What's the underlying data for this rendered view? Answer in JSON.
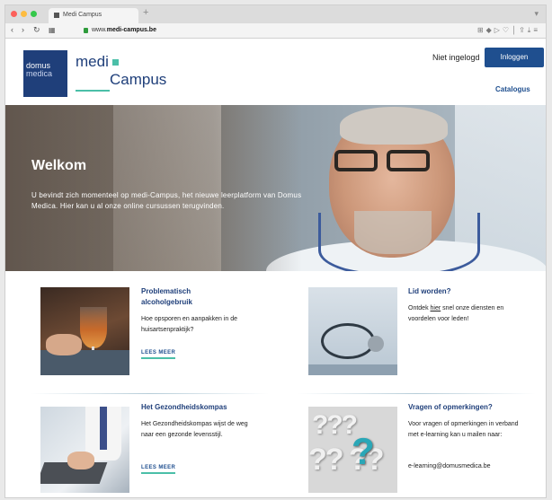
{
  "browser": {
    "tab_title": "Medi Campus",
    "url_prefix": "www.",
    "url_domain": "medi-campus.be",
    "new_tab": "+"
  },
  "header": {
    "logo_domus_line1": "domus",
    "logo_domus_line2": "medica",
    "logo_medi": "medi",
    "logo_campus": "Campus",
    "login_status": "Niet ingelogd",
    "login_button": "Inloggen",
    "catalogus": "Catalogus"
  },
  "hero": {
    "title": "Welkom",
    "text": "U bevindt zich momenteel op medi-Campus, het nieuwe leerplatform van Domus Medica. Hier kan u al onze online cursussen terugvinden."
  },
  "cards": {
    "alcohol": {
      "title": "Problematisch alcoholgebruik",
      "desc": "Hoe opsporen en aanpakken in de huisartsenpraktijk?",
      "link": "LEES MEER"
    },
    "lid": {
      "title": "Lid worden?",
      "desc_pre": "Ontdek ",
      "desc_link": "hier",
      "desc_post": " snel onze diensten en voordelen voor leden!"
    },
    "kompas": {
      "title": "Het Gezondheidskompas",
      "desc": "Het Gezondheidskompas wijst de weg naar een gezonde levensstijl.",
      "link": "LEES MEER"
    },
    "vragen": {
      "title": "Vragen of opmerkingen?",
      "desc": "Voor vragen of opmerkingen in verband met e-learning kan u mailen naar:",
      "email": "e-learning@domusmedica.be"
    }
  },
  "colors": {
    "brand": "#1f3f7a",
    "accent": "#4bbfa8",
    "button": "#1f4f8f"
  },
  "icons": [
    "back-icon",
    "forward-icon",
    "reload-icon",
    "grid-icon",
    "lock-icon",
    "shield-icon",
    "share-icon",
    "download-icon",
    "menu-icon"
  ]
}
